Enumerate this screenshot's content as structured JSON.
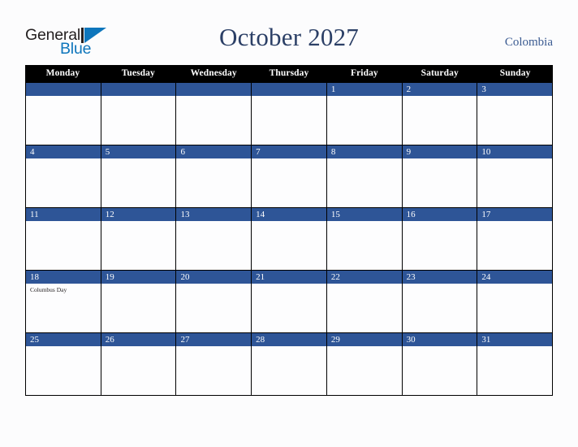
{
  "brand": {
    "word1": "General",
    "word2": "Blue",
    "mark_icon": "blue-triangle-icon",
    "color_dark": "#231f20",
    "color_blue": "#0e76bc"
  },
  "header": {
    "title": "October 2027",
    "country": "Colombia",
    "title_color": "#2b3f66",
    "country_color": "#3a5a91"
  },
  "calendar": {
    "weekday_header_bg": "#000000",
    "weekday_header_color": "#ffffff",
    "daynum_bg": "#2e5597",
    "daynum_color": "#ffffff",
    "cell_bg": "#fdfdfe",
    "border_color": "#000000",
    "weekdays": [
      "Monday",
      "Tuesday",
      "Wednesday",
      "Thursday",
      "Friday",
      "Saturday",
      "Sunday"
    ],
    "weeks": [
      [
        {
          "num": "",
          "events": []
        },
        {
          "num": "",
          "events": []
        },
        {
          "num": "",
          "events": []
        },
        {
          "num": "",
          "events": []
        },
        {
          "num": "1",
          "events": []
        },
        {
          "num": "2",
          "events": []
        },
        {
          "num": "3",
          "events": []
        }
      ],
      [
        {
          "num": "4",
          "events": []
        },
        {
          "num": "5",
          "events": []
        },
        {
          "num": "6",
          "events": []
        },
        {
          "num": "7",
          "events": []
        },
        {
          "num": "8",
          "events": []
        },
        {
          "num": "9",
          "events": []
        },
        {
          "num": "10",
          "events": []
        }
      ],
      [
        {
          "num": "11",
          "events": []
        },
        {
          "num": "12",
          "events": []
        },
        {
          "num": "13",
          "events": []
        },
        {
          "num": "14",
          "events": []
        },
        {
          "num": "15",
          "events": []
        },
        {
          "num": "16",
          "events": []
        },
        {
          "num": "17",
          "events": []
        }
      ],
      [
        {
          "num": "18",
          "events": [
            "Columbus Day"
          ]
        },
        {
          "num": "19",
          "events": []
        },
        {
          "num": "20",
          "events": []
        },
        {
          "num": "21",
          "events": []
        },
        {
          "num": "22",
          "events": []
        },
        {
          "num": "23",
          "events": []
        },
        {
          "num": "24",
          "events": []
        }
      ],
      [
        {
          "num": "25",
          "events": []
        },
        {
          "num": "26",
          "events": []
        },
        {
          "num": "27",
          "events": []
        },
        {
          "num": "28",
          "events": []
        },
        {
          "num": "29",
          "events": []
        },
        {
          "num": "30",
          "events": []
        },
        {
          "num": "31",
          "events": []
        }
      ]
    ]
  }
}
